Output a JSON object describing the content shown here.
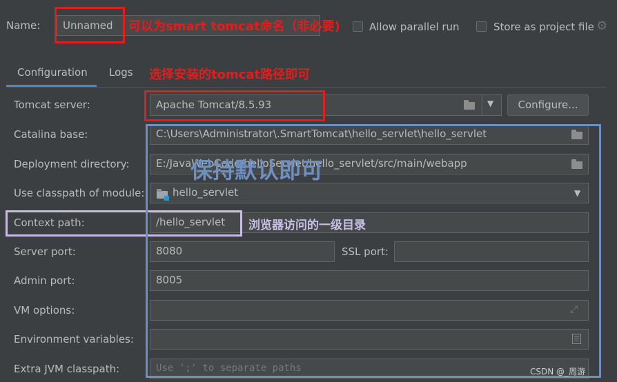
{
  "name_row": {
    "label": "Name:",
    "value": "Unnamed",
    "allow_parallel": "Allow parallel run",
    "store_project": "Store as project file"
  },
  "tabs": [
    {
      "label": "Configuration",
      "active": true
    },
    {
      "label": "Logs",
      "active": false
    }
  ],
  "form": {
    "tomcat_server": {
      "label": "Tomcat server:",
      "value": "Apache Tomcat/8.5.93",
      "button": "Configure..."
    },
    "catalina_base": {
      "label": "Catalina base:",
      "value": "C:\\Users\\Administrator\\.SmartTomcat\\hello_servlet\\hello_servlet"
    },
    "deployment_dir": {
      "label": "Deployment directory:",
      "value": "E:/JavaWebCode/helloServlet/hello_servlet/src/main/webapp"
    },
    "classpath_module": {
      "label": "Use classpath of module:",
      "value": "hello_servlet"
    },
    "context_path": {
      "label": "Context path:",
      "value": "/hello_servlet"
    },
    "server_port": {
      "label": "Server port:",
      "value": "8080"
    },
    "ssl_port": {
      "label": "SSL port:",
      "value": ""
    },
    "admin_port": {
      "label": "Admin port:",
      "value": "8005"
    },
    "vm_options": {
      "label": "VM options:",
      "value": ""
    },
    "env_vars": {
      "label": "Environment variables:",
      "value": ""
    },
    "extra_classpath": {
      "label": "Extra JVM classpath:",
      "placeholder": "Use ';' to separate paths"
    }
  },
  "annotations": {
    "name_note": "可以为smart tomcat命名（非必要)",
    "tomcat_note": "选择安装的tomcat路径即可",
    "default_note": "保持默认即可",
    "context_note": "浏览器访问的一级目录"
  },
  "watermark": "CSDN @_周游",
  "colors": {
    "background": "#3c3f41",
    "field_bg": "#45494a",
    "annotation_red": "#e31c1c",
    "annotation_blue": "#6f8fc0",
    "annotation_lavender": "#c9bde6",
    "tab_underline": "#4a88c7"
  }
}
